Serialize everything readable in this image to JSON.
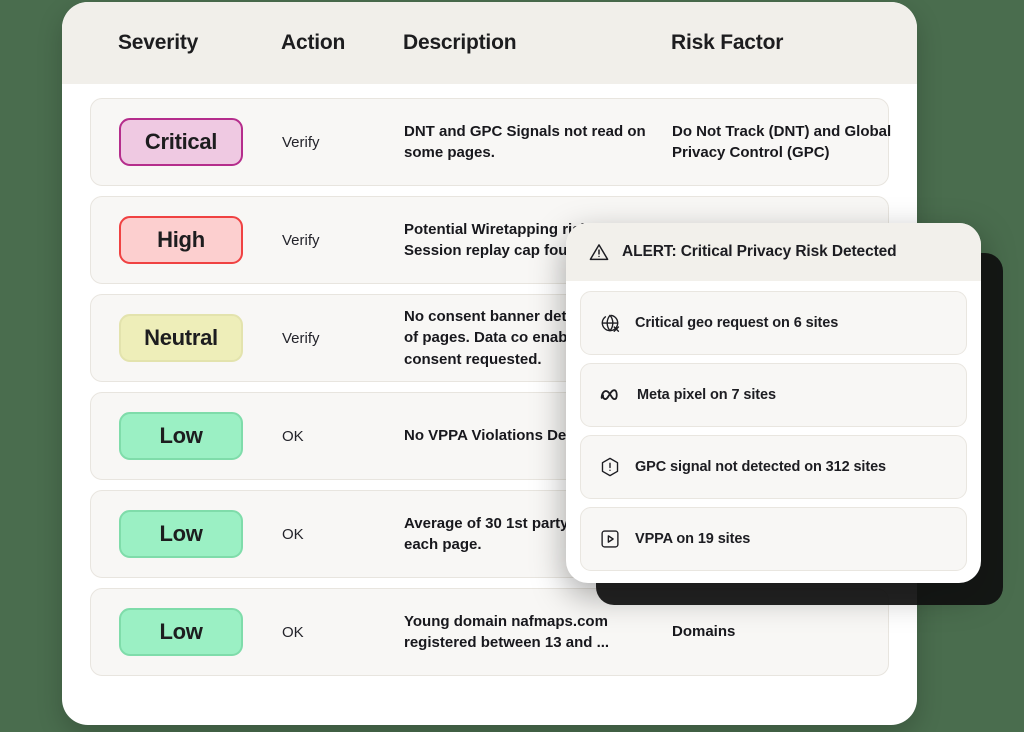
{
  "table": {
    "columns": [
      {
        "key": "severity",
        "label": "Severity"
      },
      {
        "key": "action",
        "label": "Action"
      },
      {
        "key": "description",
        "label": "Description"
      },
      {
        "key": "risk_factor",
        "label": "Risk Factor"
      }
    ],
    "rows": [
      {
        "severity": "Critical",
        "action": "Verify",
        "description": "DNT and GPC Signals not read on some pages.",
        "risk_factor": "Do Not Track (DNT) and Global Privacy Control (GPC)"
      },
      {
        "severity": "High",
        "action": "Verify",
        "description": "Potential Wiretapping risk CIPA; Session replay cap found.",
        "risk_factor": ""
      },
      {
        "severity": "Neutral",
        "action": "Verify",
        "description": "No consent banner detected >90% of pages. Data co enabled before consent requested.",
        "risk_factor": ""
      },
      {
        "severity": "Low",
        "action": "OK",
        "description": "No VPPA Violations Detected",
        "risk_factor": ""
      },
      {
        "severity": "Low",
        "action": "OK",
        "description": "Average of 30 1st party c loaded on each page.",
        "risk_factor": ""
      },
      {
        "severity": "Low",
        "action": "OK",
        "description": "Young domain nafmaps.com registered between 13 and ...",
        "risk_factor": "Domains"
      }
    ]
  },
  "alert": {
    "icon": "warning-triangle-icon",
    "title": "ALERT: Critical Privacy Risk Detected",
    "items": [
      {
        "icon": "globe-blocked-icon",
        "label": "Critical geo request on 6 sites"
      },
      {
        "icon": "meta-logo-icon",
        "label": "Meta pixel on 7 sites"
      },
      {
        "icon": "hexagon-alert-icon",
        "label": "GPC signal not detected on 312 sites"
      },
      {
        "icon": "video-play-icon",
        "label": "VPPA on 19 sites"
      }
    ]
  },
  "colors": {
    "page_background": "#4a6d4e",
    "card_background": "#ffffff",
    "header_band": "#f1efea",
    "row_background": "#f8f7f5",
    "critical_fill": "#efc9e2",
    "critical_border": "#b52d8c",
    "high_fill": "#fccfcf",
    "high_border": "#f04242",
    "neutral_fill": "#eeeeb9",
    "neutral_border": "#e3e3ad",
    "low_fill": "#9bf0c4",
    "low_border": "#7fdcaa"
  }
}
